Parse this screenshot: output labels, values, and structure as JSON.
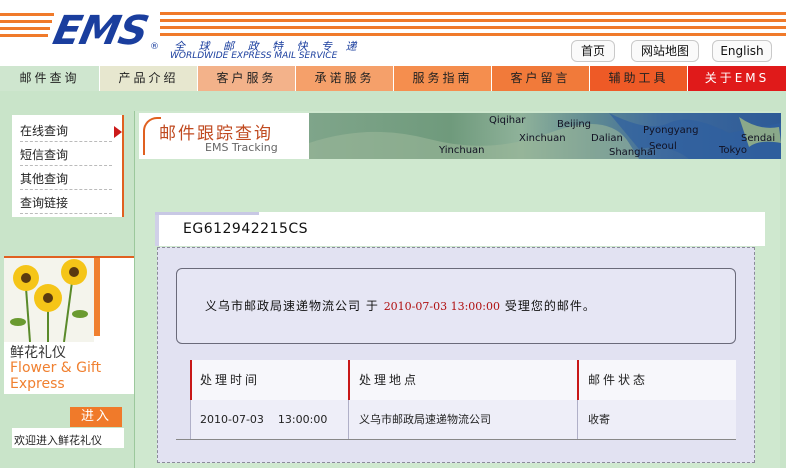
{
  "header": {
    "logo_text": "EMS",
    "tagline_cn": "全 球 邮 政 特 快 专 递",
    "tagline_en": "WORLDWIDE EXPRESS MAIL SERVICE",
    "top_links": [
      "首页",
      "网站地图",
      "English"
    ]
  },
  "nav": {
    "items": [
      "邮件查询",
      "产品介绍",
      "客户服务",
      "承诺服务",
      "服务指南",
      "客户留言",
      "辅助工具",
      "关于EMS"
    ]
  },
  "colors": {
    "nav": [
      "#cfe6cf",
      "#e7e7cf",
      "#f3b28a",
      "#f5a06a",
      "#f58e4e",
      "#f17a3a",
      "#ee5a26",
      "#e01a1a"
    ],
    "brand_blue": "#1a3e9e",
    "brand_orange": "#f07a2a",
    "date_red": "#b01010"
  },
  "left_menu": {
    "items": [
      "在线查询",
      "短信查询",
      "其他查询",
      "查询链接"
    ]
  },
  "flower_promo": {
    "title_cn": "鲜花礼仪",
    "title_en_line1": "Flower & Gift",
    "title_en_line2": "Express",
    "enter_label": "进入",
    "caption": "欢迎进入鲜花礼仪"
  },
  "banner": {
    "title": "邮件跟踪查询",
    "subtitle": "EMS Tracking",
    "map_labels": [
      "Qiqihar",
      "Beijing",
      "Pyongyang",
      "Sendai",
      "Xinchuan",
      "Seoul",
      "Tokyo",
      "Yinchuan",
      "Shanghai",
      "Dalian"
    ]
  },
  "tracking": {
    "number": "EG612942215CS",
    "summary_company": "义乌市邮政局速递物流公司",
    "summary_at": "于",
    "summary_time": "2010-07-03 13:00:00",
    "summary_action": "受理您的邮件。"
  },
  "table": {
    "headers": [
      "处理时间",
      "处理地点",
      "邮件状态"
    ],
    "rows": [
      {
        "time": "2010-07-03    13:00:00",
        "place": "义乌市邮政局速递物流公司",
        "status": "收寄"
      }
    ]
  }
}
